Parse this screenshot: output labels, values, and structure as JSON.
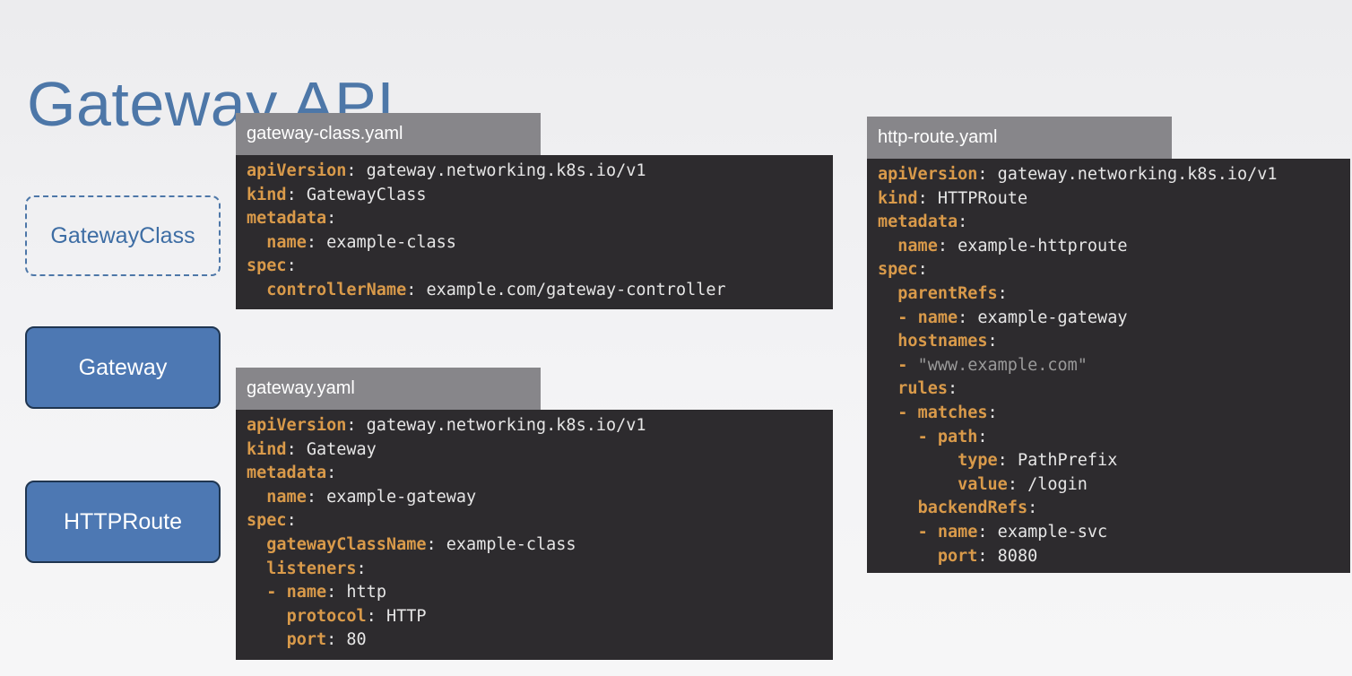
{
  "slide": {
    "title": "Gateway API"
  },
  "concepts": {
    "gateway_class": "GatewayClass",
    "gateway": "Gateway",
    "http_route": "HTTPRoute"
  },
  "files": {
    "gateway_class": {
      "filename": "gateway-class.yaml",
      "lines": [
        [
          {
            "t": "apiVersion",
            "c": "k"
          },
          {
            "t": ": gateway.networking.k8s.io/v1",
            "c": "v"
          }
        ],
        [
          {
            "t": "kind",
            "c": "k"
          },
          {
            "t": ": GatewayClass",
            "c": "v"
          }
        ],
        [
          {
            "t": "metadata",
            "c": "k"
          },
          {
            "t": ":",
            "c": "v"
          }
        ],
        [
          {
            "t": "  ",
            "c": "v"
          },
          {
            "t": "name",
            "c": "k"
          },
          {
            "t": ": example-class",
            "c": "v"
          }
        ],
        [
          {
            "t": "spec",
            "c": "k"
          },
          {
            "t": ":",
            "c": "v"
          }
        ],
        [
          {
            "t": "  ",
            "c": "v"
          },
          {
            "t": "controllerName",
            "c": "k"
          },
          {
            "t": ": example.com/gateway-controller",
            "c": "v"
          }
        ]
      ]
    },
    "gateway": {
      "filename": "gateway.yaml",
      "lines": [
        [
          {
            "t": "apiVersion",
            "c": "k"
          },
          {
            "t": ": gateway.networking.k8s.io/v1",
            "c": "v"
          }
        ],
        [
          {
            "t": "kind",
            "c": "k"
          },
          {
            "t": ": Gateway",
            "c": "v"
          }
        ],
        [
          {
            "t": "metadata",
            "c": "k"
          },
          {
            "t": ":",
            "c": "v"
          }
        ],
        [
          {
            "t": "  ",
            "c": "v"
          },
          {
            "t": "name",
            "c": "k"
          },
          {
            "t": ": example-gateway",
            "c": "v"
          }
        ],
        [
          {
            "t": "spec",
            "c": "k"
          },
          {
            "t": ":",
            "c": "v"
          }
        ],
        [
          {
            "t": "  ",
            "c": "v"
          },
          {
            "t": "gatewayClassName",
            "c": "k"
          },
          {
            "t": ": example-class",
            "c": "v"
          }
        ],
        [
          {
            "t": "  ",
            "c": "v"
          },
          {
            "t": "listeners",
            "c": "k"
          },
          {
            "t": ":",
            "c": "v"
          }
        ],
        [
          {
            "t": "  ",
            "c": "v"
          },
          {
            "t": "- ",
            "c": "k"
          },
          {
            "t": "name",
            "c": "k"
          },
          {
            "t": ": http",
            "c": "v"
          }
        ],
        [
          {
            "t": "    ",
            "c": "v"
          },
          {
            "t": "protocol",
            "c": "k"
          },
          {
            "t": ": HTTP",
            "c": "v"
          }
        ],
        [
          {
            "t": "    ",
            "c": "v"
          },
          {
            "t": "port",
            "c": "k"
          },
          {
            "t": ": 80",
            "c": "v"
          }
        ]
      ]
    },
    "http_route": {
      "filename": "http-route.yaml",
      "lines": [
        [
          {
            "t": "apiVersion",
            "c": "k"
          },
          {
            "t": ": gateway.networking.k8s.io/v1",
            "c": "v"
          }
        ],
        [
          {
            "t": "kind",
            "c": "k"
          },
          {
            "t": ": HTTPRoute",
            "c": "v"
          }
        ],
        [
          {
            "t": "metadata",
            "c": "k"
          },
          {
            "t": ":",
            "c": "v"
          }
        ],
        [
          {
            "t": "  ",
            "c": "v"
          },
          {
            "t": "name",
            "c": "k"
          },
          {
            "t": ": example-httproute",
            "c": "v"
          }
        ],
        [
          {
            "t": "spec",
            "c": "k"
          },
          {
            "t": ":",
            "c": "v"
          }
        ],
        [
          {
            "t": "  ",
            "c": "v"
          },
          {
            "t": "parentRefs",
            "c": "k"
          },
          {
            "t": ":",
            "c": "v"
          }
        ],
        [
          {
            "t": "  ",
            "c": "v"
          },
          {
            "t": "- ",
            "c": "k"
          },
          {
            "t": "name",
            "c": "k"
          },
          {
            "t": ": example-gateway",
            "c": "v"
          }
        ],
        [
          {
            "t": "  ",
            "c": "v"
          },
          {
            "t": "hostnames",
            "c": "k"
          },
          {
            "t": ":",
            "c": "v"
          }
        ],
        [
          {
            "t": "  ",
            "c": "v"
          },
          {
            "t": "- ",
            "c": "k"
          },
          {
            "t": "\"www.example.com\"",
            "c": "s"
          }
        ],
        [
          {
            "t": "  ",
            "c": "v"
          },
          {
            "t": "rules",
            "c": "k"
          },
          {
            "t": ":",
            "c": "v"
          }
        ],
        [
          {
            "t": "  ",
            "c": "v"
          },
          {
            "t": "- ",
            "c": "k"
          },
          {
            "t": "matches",
            "c": "k"
          },
          {
            "t": ":",
            "c": "v"
          }
        ],
        [
          {
            "t": "    ",
            "c": "v"
          },
          {
            "t": "- ",
            "c": "k"
          },
          {
            "t": "path",
            "c": "k"
          },
          {
            "t": ":",
            "c": "v"
          }
        ],
        [
          {
            "t": "        ",
            "c": "v"
          },
          {
            "t": "type",
            "c": "k"
          },
          {
            "t": ": PathPrefix",
            "c": "v"
          }
        ],
        [
          {
            "t": "        ",
            "c": "v"
          },
          {
            "t": "value",
            "c": "k"
          },
          {
            "t": ": /login",
            "c": "v"
          }
        ],
        [
          {
            "t": "    ",
            "c": "v"
          },
          {
            "t": "backendRefs",
            "c": "k"
          },
          {
            "t": ":",
            "c": "v"
          }
        ],
        [
          {
            "t": "    ",
            "c": "v"
          },
          {
            "t": "- ",
            "c": "k"
          },
          {
            "t": "name",
            "c": "k"
          },
          {
            "t": ": example-svc",
            "c": "v"
          }
        ],
        [
          {
            "t": "      ",
            "c": "v"
          },
          {
            "t": "port",
            "c": "k"
          },
          {
            "t": ": 8080",
            "c": "v"
          }
        ]
      ]
    }
  },
  "colors": {
    "title": "#4d77a8",
    "concept_fill": "#4d78b3",
    "tab_bg": "#87868a",
    "code_bg": "#2d2b2e",
    "yaml_key": "#d99a4a",
    "yaml_value": "#e6e6e6",
    "yaml_string": "#9a9a9a"
  }
}
